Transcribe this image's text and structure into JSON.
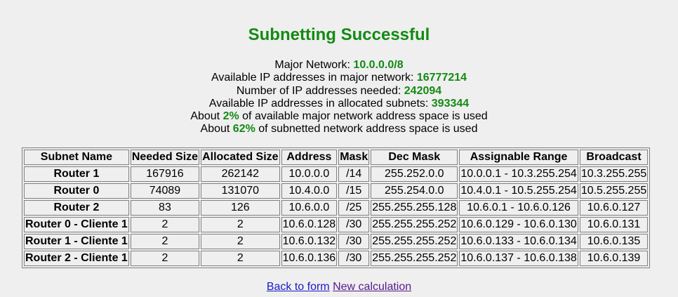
{
  "title": "Subnetting Successful",
  "summary": {
    "major_network_label": "Major Network:",
    "major_network_value": "10.0.0.0/8",
    "available_major_label": "Available IP addresses in major network:",
    "available_major_value": "16777214",
    "needed_label": "Number of IP addresses needed:",
    "needed_value": "242094",
    "available_alloc_label": "Available IP addresses in allocated subnets:",
    "available_alloc_value": "393344",
    "major_used_prefix": "About",
    "major_used_value": "2%",
    "major_used_suffix": "of available major network address space is used",
    "subnet_used_prefix": "About",
    "subnet_used_value": "62%",
    "subnet_used_suffix": "of subnetted network address space is used"
  },
  "table": {
    "headers": [
      "Subnet Name",
      "Needed Size",
      "Allocated Size",
      "Address",
      "Mask",
      "Dec Mask",
      "Assignable Range",
      "Broadcast"
    ],
    "rows": [
      [
        "Router 1",
        "167916",
        "262142",
        "10.0.0.0",
        "/14",
        "255.252.0.0",
        "10.0.0.1 - 10.3.255.254",
        "10.3.255.255"
      ],
      [
        "Router 0",
        "74089",
        "131070",
        "10.4.0.0",
        "/15",
        "255.254.0.0",
        "10.4.0.1 - 10.5.255.254",
        "10.5.255.255"
      ],
      [
        "Router 2",
        "83",
        "126",
        "10.6.0.0",
        "/25",
        "255.255.255.128",
        "10.6.0.1 - 10.6.0.126",
        "10.6.0.127"
      ],
      [
        "Router 0 - Cliente 1",
        "2",
        "2",
        "10.6.0.128",
        "/30",
        "255.255.255.252",
        "10.6.0.129 - 10.6.0.130",
        "10.6.0.131"
      ],
      [
        "Router 1 - Cliente 1",
        "2",
        "2",
        "10.6.0.132",
        "/30",
        "255.255.255.252",
        "10.6.0.133 - 10.6.0.134",
        "10.6.0.135"
      ],
      [
        "Router 2 - Cliente 1",
        "2",
        "2",
        "10.6.0.136",
        "/30",
        "255.255.255.252",
        "10.6.0.137 - 10.6.0.138",
        "10.6.0.139"
      ]
    ]
  },
  "links": {
    "back": "Back to form",
    "new": "New calculation"
  }
}
